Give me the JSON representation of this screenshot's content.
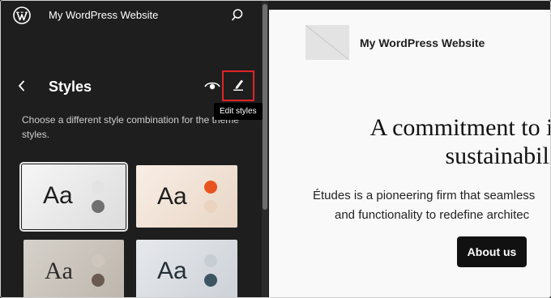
{
  "header": {
    "site_title": "My WordPress Website"
  },
  "panel": {
    "title": "Styles",
    "description": "Choose a different style combination for the theme styles.",
    "edit_tooltip": "Edit styles"
  },
  "variations": [
    {
      "sample": "Aa",
      "colors": [
        "#e3e3e3",
        "#707070"
      ],
      "selected": true
    },
    {
      "sample": "Aa",
      "colors": [
        "#e8541f",
        "#ecd3c0"
      ],
      "selected": false
    },
    {
      "sample": "Aa",
      "colors": [
        "#cfc7bd",
        "#6b5a4f"
      ],
      "selected": false
    },
    {
      "sample": "Aa",
      "colors": [
        "#c6ced4",
        "#3d5563"
      ],
      "selected": false
    }
  ],
  "canvas": {
    "site_title": "My WordPress Website",
    "headline_line1": "A commitment to inno",
    "headline_line2": "sustainability",
    "body_line1": "Études is a pioneering firm that seamless",
    "body_line2": "and functionality to redefine architec",
    "button_label": "About us"
  },
  "icons": [
    "wordpress-logo-icon",
    "search-icon",
    "back-chevron-icon",
    "eye-icon",
    "pencil-icon"
  ],
  "colors": {
    "sidebar_bg": "#1e1e1e",
    "highlight": "#e02424",
    "canvas_bg": "#f9f9f9"
  }
}
